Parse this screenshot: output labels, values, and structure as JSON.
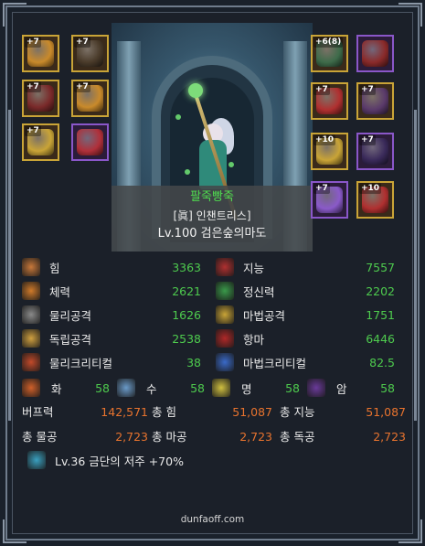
{
  "character": {
    "name": "팔죽빵죽",
    "title": "[眞] 인챈트리스]",
    "level_text": "Lv.100 검은숲의마도"
  },
  "equipment": {
    "left": [
      {
        "badge": "+7",
        "icon": "shoulder-armor-icon",
        "color": "#c98a2b"
      },
      {
        "badge": "+7",
        "icon": "top-armor-icon",
        "color": "#4a3b2a"
      },
      {
        "badge": "+7",
        "icon": "pants-icon",
        "color": "#7a2a2a"
      },
      {
        "badge": "+7",
        "icon": "belt-icon",
        "color": "#c98a2b"
      },
      {
        "badge": "+7",
        "icon": "shoes-icon",
        "color": "#c9a437"
      },
      {
        "badge": "",
        "icon": "title-avatar-icon",
        "color": "#b0303a"
      }
    ],
    "right": [
      {
        "badge": "+6(8)",
        "icon": "weapon-icon",
        "color": "#3e6b4a"
      },
      {
        "badge": "",
        "icon": "creature-icon",
        "color": "#8a2a2a"
      },
      {
        "badge": "+7",
        "icon": "bracelet-icon",
        "color": "#b03030"
      },
      {
        "badge": "+7",
        "icon": "necklace-icon",
        "color": "#5a3a6a"
      },
      {
        "badge": "+10",
        "icon": "ring-icon",
        "color": "#c9a437"
      },
      {
        "badge": "+7",
        "icon": "support-icon",
        "color": "#3a2a5a"
      },
      {
        "badge": "+7",
        "icon": "magic-stone-icon",
        "color": "#8a5ac9"
      },
      {
        "badge": "+10",
        "icon": "earring-icon",
        "color": "#b03030"
      }
    ]
  },
  "stats": {
    "rows": [
      {
        "l_icon": "strength-icon",
        "l_label": "힘",
        "l_value": "3363",
        "r_icon": "intelligence-icon",
        "r_label": "지능",
        "r_value": "7557"
      },
      {
        "l_icon": "vitality-icon",
        "l_label": "체력",
        "l_value": "2621",
        "r_icon": "spirit-icon",
        "r_label": "정신력",
        "r_value": "2202"
      },
      {
        "l_icon": "physical-attack-icon",
        "l_label": "물리공격",
        "l_value": "1626",
        "r_icon": "magic-attack-icon",
        "r_label": "마법공격",
        "r_value": "1751"
      },
      {
        "l_icon": "independent-attack-icon",
        "l_label": "독립공격",
        "l_value": "2538",
        "r_icon": "anti-magic-icon",
        "r_label": "항마",
        "r_value": "6446"
      },
      {
        "l_icon": "physical-crit-icon",
        "l_label": "물리크리티컬",
        "l_value": "38",
        "r_icon": "magic-crit-icon",
        "r_label": "마법크리티컬",
        "r_value": "82.5"
      }
    ],
    "elements": [
      {
        "icon": "fire-icon",
        "label": "화",
        "value": "58"
      },
      {
        "icon": "water-icon",
        "label": "수",
        "value": "58"
      },
      {
        "icon": "light-icon",
        "label": "명",
        "value": "58"
      },
      {
        "icon": "dark-icon",
        "label": "암",
        "value": "58"
      }
    ],
    "buff": [
      {
        "label": "버프력",
        "value": "142,571"
      },
      {
        "label": "총 힘",
        "value": "51,087"
      },
      {
        "label": "총 지능",
        "value": "51,087"
      }
    ],
    "totals": [
      {
        "label": "총 물공",
        "value": "2,723"
      },
      {
        "label": "총 마공",
        "value": "2,723"
      },
      {
        "label": "총 독공",
        "value": "2,723"
      }
    ],
    "curse": {
      "icon": "curse-icon",
      "text": "Lv.36 금단의 저주 +70%"
    }
  },
  "footer": {
    "site": "dunfaoff.com"
  },
  "colors": {
    "green": "#4ecb4e",
    "orange": "#e8732e",
    "gold_border": "#c9a437",
    "epic_border": "#8a57c9"
  }
}
